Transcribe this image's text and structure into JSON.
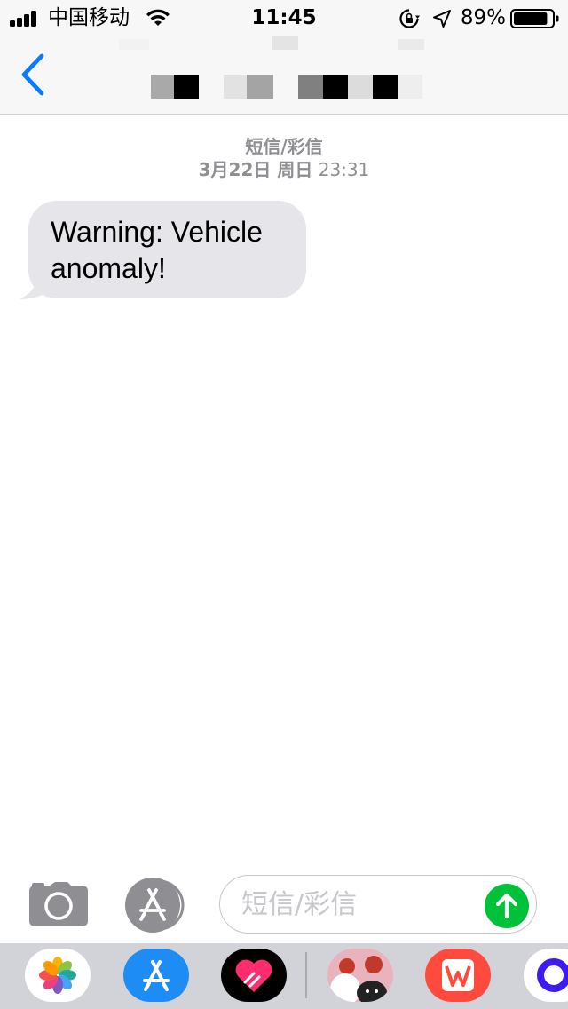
{
  "status_bar": {
    "carrier": "中国移动",
    "time": "11:45",
    "battery_percent": "89%",
    "battery_level": 0.89,
    "icons": [
      "signal-icon",
      "wifi-icon",
      "orientation-lock-icon",
      "location-icon",
      "battery-icon"
    ]
  },
  "nav": {
    "back_icon": "chevron-left-icon",
    "accent_color": "#0a7aff"
  },
  "thread": {
    "service_label": "短信/彩信",
    "date": "3月22日 周日",
    "time": "23:31",
    "messages": [
      {
        "direction": "incoming",
        "text": "Warning: Vehicle anomaly!"
      }
    ]
  },
  "composer": {
    "placeholder": "短信/彩信",
    "icons": [
      "camera-icon",
      "app-store-icon",
      "send-arrow-icon"
    ],
    "send_color": "#00c23a"
  },
  "app_drawer": {
    "apps": [
      "photos-icon",
      "app-store-icon",
      "heart-app-icon",
      "sticker-app-icon",
      "wps-app-icon",
      "circle-app-icon"
    ]
  }
}
